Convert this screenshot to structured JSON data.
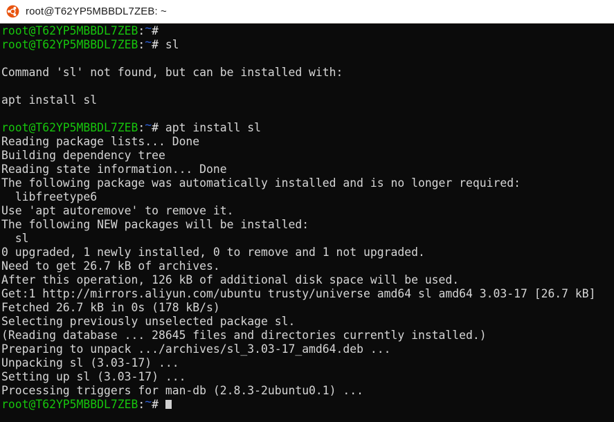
{
  "window": {
    "title": "root@T62YP5MBBDL7ZEB: ~",
    "icon": "ubuntu-logo-icon",
    "background_color": "#0b0b0b",
    "titlebar_color": "#ffffff",
    "text_color": "#d8d8d8",
    "prompt_color": "#16c60c",
    "tilde_color": "#2c5fd8"
  },
  "terminal": {
    "prompt": {
      "user_host": "root@T62YP5MBBDL7ZEB",
      "separator": ":",
      "path": "~",
      "symbol": "#"
    },
    "lines": [
      {
        "type": "prompt",
        "command": ""
      },
      {
        "type": "prompt",
        "command": " sl"
      },
      {
        "type": "output",
        "text": ""
      },
      {
        "type": "output",
        "text": "Command 'sl' not found, but can be installed with:"
      },
      {
        "type": "output",
        "text": ""
      },
      {
        "type": "output",
        "text": "apt install sl"
      },
      {
        "type": "output",
        "text": ""
      },
      {
        "type": "prompt",
        "command": " apt install sl"
      },
      {
        "type": "output",
        "text": "Reading package lists... Done"
      },
      {
        "type": "output",
        "text": "Building dependency tree"
      },
      {
        "type": "output",
        "text": "Reading state information... Done"
      },
      {
        "type": "output",
        "text": "The following package was automatically installed and is no longer required:"
      },
      {
        "type": "output",
        "text": "  libfreetype6"
      },
      {
        "type": "output",
        "text": "Use 'apt autoremove' to remove it."
      },
      {
        "type": "output",
        "text": "The following NEW packages will be installed:"
      },
      {
        "type": "output",
        "text": "  sl"
      },
      {
        "type": "output",
        "text": "0 upgraded, 1 newly installed, 0 to remove and 1 not upgraded."
      },
      {
        "type": "output",
        "text": "Need to get 26.7 kB of archives."
      },
      {
        "type": "output",
        "text": "After this operation, 126 kB of additional disk space will be used."
      },
      {
        "type": "output",
        "text": "Get:1 http://mirrors.aliyun.com/ubuntu trusty/universe amd64 sl amd64 3.03-17 [26.7 kB]"
      },
      {
        "type": "output",
        "text": "Fetched 26.7 kB in 0s (178 kB/s)"
      },
      {
        "type": "output",
        "text": "Selecting previously unselected package sl."
      },
      {
        "type": "output",
        "text": "(Reading database ... 28645 files and directories currently installed.)"
      },
      {
        "type": "output",
        "text": "Preparing to unpack .../archives/sl_3.03-17_amd64.deb ..."
      },
      {
        "type": "output",
        "text": "Unpacking sl (3.03-17) ..."
      },
      {
        "type": "output",
        "text": "Setting up sl (3.03-17) ..."
      },
      {
        "type": "output",
        "text": "Processing triggers for man-db (2.8.3-2ubuntu0.1) ..."
      },
      {
        "type": "prompt",
        "command": "",
        "cursor": true
      }
    ]
  }
}
